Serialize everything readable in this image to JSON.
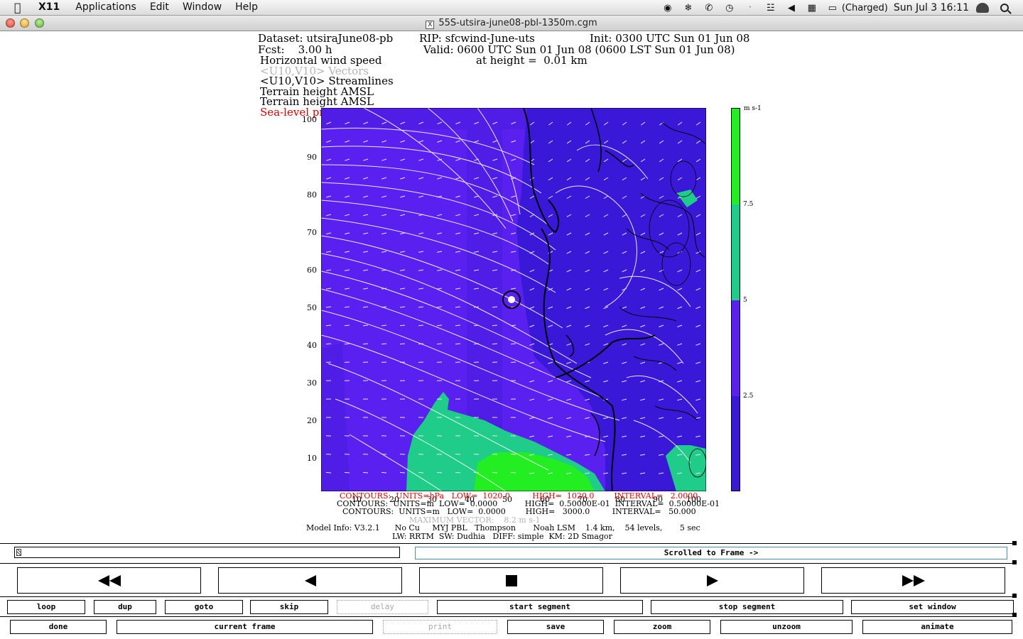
{
  "menubar": {
    "app_name": "X11",
    "menus": [
      "Applications",
      "Edit",
      "Window",
      "Help"
    ],
    "battery_status": "(Charged)",
    "clock": "Sun Jul 3  16:11",
    "icons": [
      "alien-icon",
      "bluetooth-icon",
      "phone-icon",
      "time-machine-icon",
      "bluetooth-alt-icon",
      "wifi-icon",
      "volume-icon",
      "calendar-icon",
      "battery-icon",
      "user-icon",
      "spotlight-icon"
    ]
  },
  "window": {
    "title": "55S-utsira-june08-pbl-1350m.cgm"
  },
  "plot_header": {
    "dataset": "Dataset: utsiraJune08-pb",
    "rip": "RIP: sfcwind-June-uts",
    "init": "Init: 0300 UTC Sun 01 Jun 08",
    "fcst": "Fcst:    3.00 h",
    "valid": "Valid: 0600 UTC Sun 01 Jun 08 (0600 LST Sun 01 Jun 08)",
    "field1": "Horizontal wind speed",
    "height": "at height =  0.01 km",
    "field2": "<U10,V10> Vectors",
    "field3": "<U10,V10> Streamlines",
    "field4": "Terrain height AMSL",
    "field5": "Terrain height AMSL",
    "field6": "Sea-level pressure"
  },
  "map": {
    "y_ticks": [
      "100",
      "90",
      "80",
      "70",
      "60",
      "50",
      "40",
      "30",
      "20",
      "10"
    ],
    "x_ticks": [
      "10",
      "20",
      "30",
      "40",
      "50",
      "60",
      "70",
      "80",
      "90",
      "100"
    ],
    "colors": {
      "c1": "#3a18d8",
      "c2": "#5a20f0",
      "c3": "#1fcc8a",
      "c4": "#22ee22"
    }
  },
  "colorbar": {
    "unit": "m s-1",
    "labels": [
      "7.5",
      "5",
      "2.5"
    ],
    "colors": [
      "#22ee22",
      "#1fcc8a",
      "#5a20f0",
      "#3a18d8"
    ]
  },
  "footer": {
    "contours1": "CONTOURS:  UNITS=hPa   LOW=  1020.0         HIGH=  1020.0        INTERVAL=   2.0000",
    "contours2": "CONTOURS:  UNITS=m  LOW=  0.0000           HIGH=  0.50000E-01  INTERVAL=  0.50000E-01",
    "contours3": "CONTOURS:  UNITS=m   LOW=  0.0000        HIGH=   3000.0         INTERVAL=   50.000",
    "max_vector": "MAXIMUM VECTOR:    8.2 m s-1",
    "model_info": "Model Info: V3.2.1      No Cu     MYJ PBL   Thompson       Noah LSM    1.4 km,    54 levels,       5 sec",
    "model_info2": "LW: RRTM  SW: Dudhia   DIFF: simple  KM: 2D Smagor"
  },
  "controls": {
    "frame_status": "Scrolled to Frame ->",
    "row1": [
      "loop",
      "dup",
      "goto",
      "skip",
      "delay",
      "start segment",
      "stop segment",
      "set window"
    ],
    "row2": [
      "done",
      "current frame",
      "print",
      "save",
      "zoom",
      "unzoom",
      "animate"
    ]
  }
}
